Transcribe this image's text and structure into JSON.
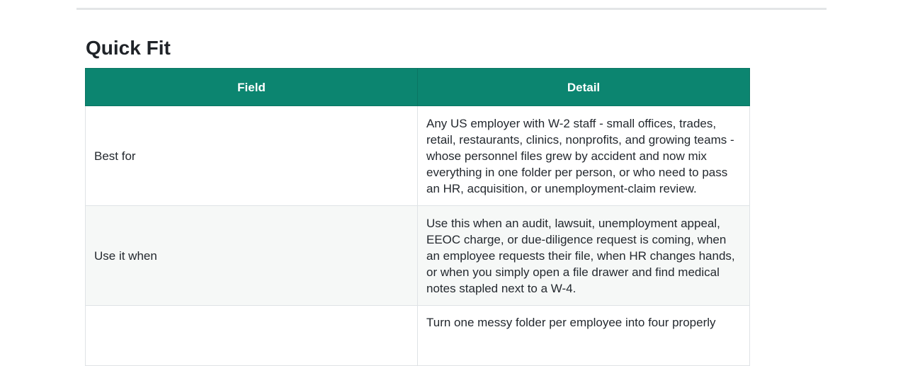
{
  "section": {
    "title": "Quick Fit"
  },
  "table": {
    "headers": [
      "Field",
      "Detail"
    ],
    "rows": [
      {
        "field": "Best for",
        "detail": "Any US employer with W-2 staff - small offices, trades, retail, restaurants, clinics, nonprofits, and growing teams - whose personnel files grew by accident and now mix everything in one folder per person, or who need to pass an HR, acquisition, or unemployment-claim review."
      },
      {
        "field": "Use it when",
        "detail": "Use this when an audit, lawsuit, unemployment appeal, EEOC charge, or due-diligence request is coming, when an employee requests their file, when HR changes hands, or when you simply open a file drawer and find medical notes stapled next to a W-4."
      },
      {
        "field": "",
        "detail": "Turn one messy folder per employee into four properly"
      }
    ]
  },
  "colors": {
    "header_bg": "#0c8570",
    "header_text": "#ffffff",
    "alt_row_bg": "#f6f8f7",
    "border": "#dfe3e6"
  }
}
